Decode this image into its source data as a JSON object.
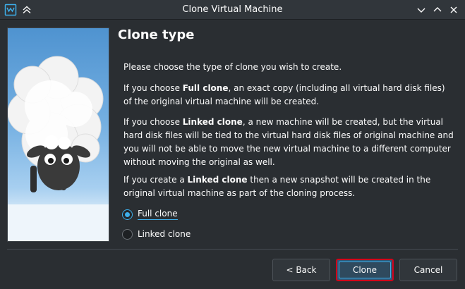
{
  "window": {
    "title": "Clone Virtual Machine"
  },
  "page": {
    "heading": "Clone type",
    "intro": "Please choose the type of clone you wish to create.",
    "full_clone_para": {
      "pre": "If you choose ",
      "bold": "Full clone",
      "post": ", an exact copy (including all virtual hard disk files) of the original virtual machine will be created."
    },
    "linked_clone_para": {
      "pre": "If you choose ",
      "bold": "Linked clone",
      "post": ", a new machine will be created, but the virtual hard disk files will be tied to the virtual hard disk files of original machine and you will not be able to move the new virtual machine to a different computer without moving the original as well."
    },
    "snapshot_para": {
      "pre": "If you create a ",
      "bold": "Linked clone",
      "post": " then a new snapshot will be created in the original virtual machine as part of the cloning process."
    },
    "options": [
      {
        "label": "Full clone",
        "checked": true
      },
      {
        "label": "Linked clone",
        "checked": false
      }
    ]
  },
  "buttons": {
    "back": "< Back",
    "clone": "Clone",
    "cancel": "Cancel"
  },
  "colors": {
    "accent": "#3daee9",
    "highlight_border": "#d0021b",
    "background": "#2a2e32"
  }
}
